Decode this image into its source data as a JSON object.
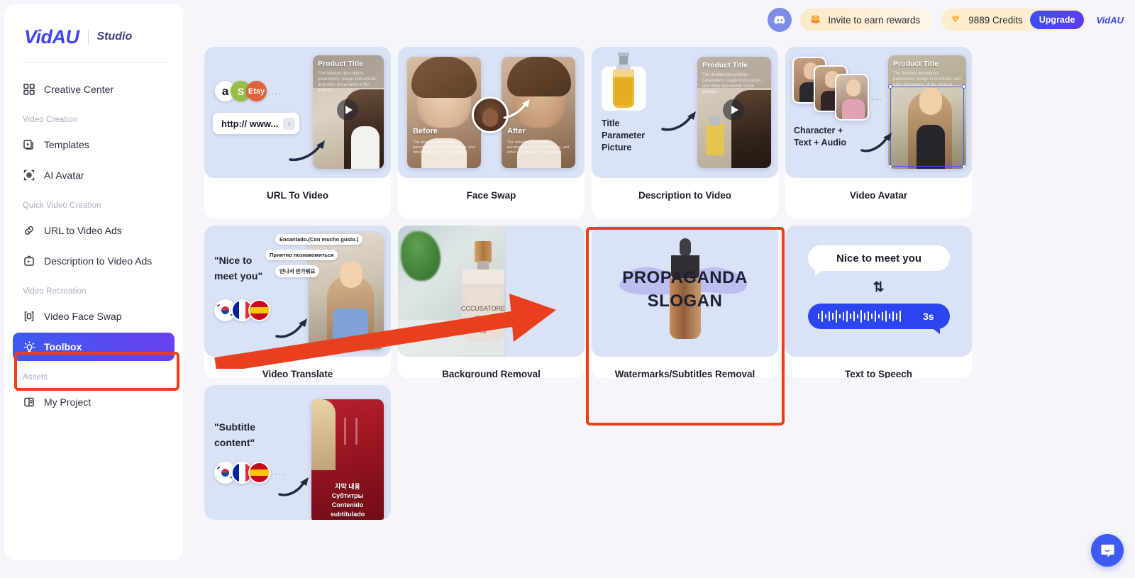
{
  "brand": {
    "logo": "VidAU",
    "sub": "Studio"
  },
  "header": {
    "discord_icon": "discord-icon",
    "invite_label": "Invite to earn rewards",
    "invite_icon": "coins-icon",
    "credits_label": "9889 Credits",
    "credits_icon": "gem-icon",
    "upgrade_label": "Upgrade",
    "badge_label": "VidAU"
  },
  "sidebar": {
    "items": [
      {
        "label": "Creative Center",
        "icon": "grid-icon",
        "type": "item",
        "active": false
      },
      {
        "label": "Video Creation",
        "type": "group"
      },
      {
        "label": "Templates",
        "icon": "templates-icon",
        "type": "item",
        "active": false
      },
      {
        "label": "AI Avatar",
        "icon": "avatar-icon",
        "type": "item",
        "active": false
      },
      {
        "label": "Quick Video Creation",
        "type": "group"
      },
      {
        "label": "URL to Video Ads",
        "icon": "link-icon",
        "type": "item",
        "active": false
      },
      {
        "label": "Description to Video Ads",
        "icon": "description-video-icon",
        "type": "item",
        "active": false
      },
      {
        "label": "Video Recreation",
        "type": "group"
      },
      {
        "label": "Video Face Swap",
        "icon": "face-swap-icon",
        "type": "item",
        "active": false
      },
      {
        "label": "Toolbox",
        "icon": "lightbulb-icon",
        "type": "item",
        "active": true
      },
      {
        "label": "Assets",
        "type": "group"
      },
      {
        "label": "My Project",
        "icon": "project-icon",
        "type": "item",
        "active": false
      }
    ]
  },
  "cards": {
    "url_to_video": {
      "label": "URL To Video",
      "url_text": "http:// www...",
      "badges": [
        "a",
        "S",
        "Etsy"
      ],
      "dots": "...",
      "product_title": "Product Title",
      "product_desc": "The detailed description, parameters, usage instructions, and other documents of the product."
    },
    "face_swap": {
      "label": "Face Swap",
      "before_label": "Before",
      "after_label": "After",
      "desc": "The detailed description, parameters, usage instructions, and other documents of the product."
    },
    "description_to_video": {
      "label": "Description to Video",
      "input_lines": [
        "Title",
        "Parameter",
        "Picture"
      ],
      "product_title": "Product Title",
      "product_desc": "The detailed description, parameters, usage instructions, and other documents of the product."
    },
    "video_avatar": {
      "label": "Video Avatar",
      "input_lines": [
        "Character +",
        "Text + Audio"
      ],
      "dots": "...",
      "product_title": "Product Title",
      "product_desc": "The detailed description, parameters, usage instructions, and other documents of the product."
    },
    "video_translate": {
      "label": "Video Translate",
      "source_text": "\"Nice to\nmeet you\"",
      "source_line1": "\"Nice to",
      "source_line2": "meet you\"",
      "translations": [
        "Encantado.(Con mucho gusto.)",
        "Приятно познакомиться",
        "만나서 반가워요"
      ],
      "flags": [
        "KR",
        "FR",
        "ES"
      ]
    },
    "background_removal": {
      "label": "Background Removal",
      "bottle_text1": "CCCUSATORE",
      "bottle_text2": "CERBTK",
      "bottle_text3": "Cer"
    },
    "watermarks_removal": {
      "label": "Watermarks/Subtitles Removal",
      "overlay_line1": "PROPAGANDA",
      "overlay_line2": "SLOGAN"
    },
    "text_to_speech": {
      "label": "Text to Speech",
      "bubble_text": "Nice to meet you",
      "convert_icon": "up-down-arrow-icon",
      "duration": "3s"
    },
    "subtitle_translate": {
      "label": "",
      "source_line1": "\"Subtitle",
      "source_line2": "content\"",
      "flags": [
        "KR",
        "FR",
        "ES"
      ],
      "dots": "...",
      "subtitle_lines": [
        "자막 내용",
        "Субтитры",
        "Contenido",
        "subtitulado"
      ]
    }
  },
  "annotations": {
    "highlight_color": "#f03c18",
    "arrow_color": "#e8401f",
    "highlighted_sidebar_item": "Toolbox",
    "highlighted_card": "Watermarks/Subtitles Removal"
  },
  "chat": {
    "icon": "chat-bubble-icon"
  },
  "colors": {
    "accent": "#4043f5",
    "page_bg": "#f5f6fb",
    "card_thumb_bg": "#dae2f6",
    "credits_bg": "#fdeccd"
  }
}
